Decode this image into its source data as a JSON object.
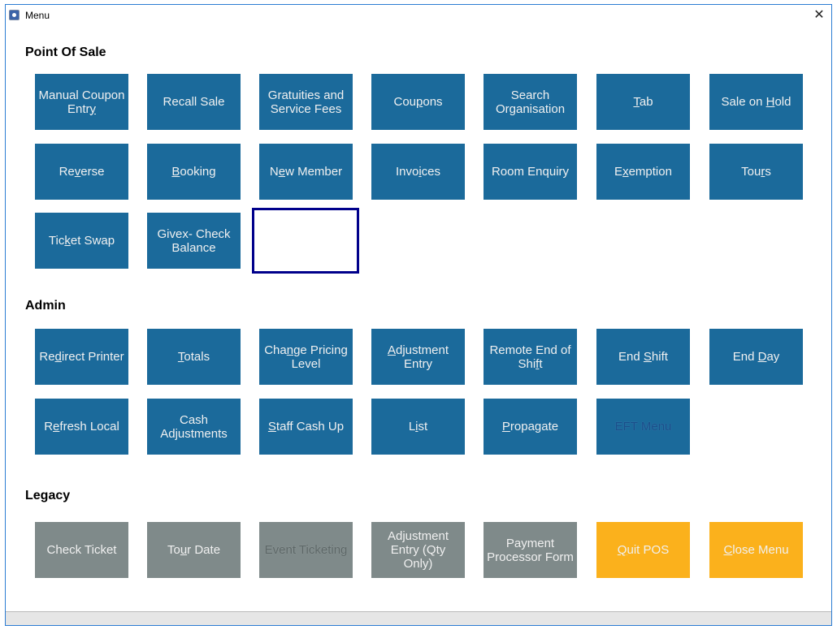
{
  "window": {
    "title": "Menu",
    "icon": "app-icon",
    "close_label": "✕"
  },
  "colors": {
    "button_blue": "#1b6a9b",
    "button_grey": "#7f8a8a",
    "button_orange": "#fbb11c",
    "focus_ring": "#00008b"
  },
  "sections": [
    {
      "title": "Point Of Sale",
      "buttons": [
        {
          "label": "Manual Coupon Entry",
          "mnemonic_index": 18,
          "color": "blue",
          "enabled": true
        },
        {
          "label": "Recall Sale",
          "mnemonic_index": -1,
          "color": "blue",
          "enabled": true
        },
        {
          "label": "Gratuities and Service Fees",
          "mnemonic_index": -1,
          "color": "blue",
          "enabled": true
        },
        {
          "label": "Coupons",
          "mnemonic_index": 3,
          "color": "blue",
          "enabled": true
        },
        {
          "label": "Search Organisation",
          "mnemonic_index": -1,
          "color": "blue",
          "enabled": true
        },
        {
          "label": "Tab",
          "mnemonic_index": 0,
          "color": "blue",
          "enabled": true
        },
        {
          "label": "Sale on Hold",
          "mnemonic_index": 8,
          "color": "blue",
          "enabled": true
        },
        {
          "label": "Reverse",
          "mnemonic_index": 2,
          "color": "blue",
          "enabled": true
        },
        {
          "label": "Booking",
          "mnemonic_index": 0,
          "color": "blue",
          "enabled": true
        },
        {
          "label": "New Member",
          "mnemonic_index": 1,
          "color": "blue",
          "enabled": true
        },
        {
          "label": "Invoices",
          "mnemonic_index": 4,
          "color": "blue",
          "enabled": true
        },
        {
          "label": "Room Enquiry",
          "mnemonic_index": -1,
          "color": "blue",
          "enabled": true
        },
        {
          "label": "Exemption",
          "mnemonic_index": 1,
          "color": "blue",
          "enabled": true
        },
        {
          "label": "Tours",
          "mnemonic_index": 3,
          "color": "blue",
          "enabled": true
        },
        {
          "label": "Ticket Swap",
          "mnemonic_index": 3,
          "color": "blue",
          "enabled": true
        },
        {
          "label": "Givex- Check Balance",
          "mnemonic_index": -1,
          "color": "blue",
          "enabled": true,
          "focused": true
        }
      ]
    },
    {
      "title": "Admin",
      "buttons": [
        {
          "label": "Redirect Printer",
          "mnemonic_index": 2,
          "color": "blue",
          "enabled": true
        },
        {
          "label": "Totals",
          "mnemonic_index": 0,
          "color": "blue",
          "enabled": true
        },
        {
          "label": "Change Pricing Level",
          "mnemonic_index": 3,
          "color": "blue",
          "enabled": true
        },
        {
          "label": "Adjustment Entry",
          "mnemonic_index": 0,
          "color": "blue",
          "enabled": true
        },
        {
          "label": "Remote End of Shift",
          "mnemonic_index": 17,
          "color": "blue",
          "enabled": true
        },
        {
          "label": "End Shift",
          "mnemonic_index": 4,
          "color": "blue",
          "enabled": true
        },
        {
          "label": "End Day",
          "mnemonic_index": 4,
          "color": "blue",
          "enabled": true
        },
        {
          "label": "Refresh Local",
          "mnemonic_index": 1,
          "color": "blue",
          "enabled": true
        },
        {
          "label": "Cash Adjustments",
          "mnemonic_index": 7,
          "color": "blue",
          "enabled": true
        },
        {
          "label": "Staff Cash Up",
          "mnemonic_index": 0,
          "color": "blue",
          "enabled": true
        },
        {
          "label": "List",
          "mnemonic_index": 1,
          "color": "blue",
          "enabled": true
        },
        {
          "label": "Propagate",
          "mnemonic_index": 0,
          "color": "blue",
          "enabled": true
        },
        {
          "label": "EFT Menu",
          "mnemonic_index": -1,
          "color": "blue",
          "enabled": false
        }
      ]
    },
    {
      "title": "Legacy",
      "buttons": [
        {
          "label": "Check Ticket",
          "mnemonic_index": -1,
          "color": "grey",
          "enabled": true
        },
        {
          "label": "Tour Date",
          "mnemonic_index": 2,
          "color": "grey",
          "enabled": true
        },
        {
          "label": "Event Ticketing",
          "mnemonic_index": -1,
          "color": "grey",
          "enabled": false
        },
        {
          "label": "Adjustment Entry (Qty Only)",
          "mnemonic_index": -1,
          "color": "grey",
          "enabled": true
        },
        {
          "label": "Payment Processor Form",
          "mnemonic_index": -1,
          "color": "grey",
          "enabled": true
        },
        {
          "label": "Quit POS",
          "mnemonic_index": 0,
          "color": "orange",
          "enabled": true
        },
        {
          "label": "Close Menu",
          "mnemonic_index": 0,
          "color": "orange",
          "enabled": true
        }
      ]
    }
  ],
  "statusbar": {
    "text": ""
  }
}
